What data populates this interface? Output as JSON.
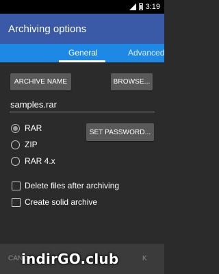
{
  "status_bar": {
    "time": "3:19",
    "icons": [
      "signal-icon",
      "battery-icon"
    ]
  },
  "app_bar": {
    "title": "Archiving options"
  },
  "tabs": [
    {
      "label": "General",
      "selected": true
    },
    {
      "label": "Advanced",
      "selected": false
    }
  ],
  "archive_name": {
    "button_label": "ARCHIVE NAME",
    "browse_label": "BROWSE...",
    "value": "samples.rar"
  },
  "format": {
    "options": [
      {
        "label": "RAR",
        "checked": true
      },
      {
        "label": "ZIP",
        "checked": false
      },
      {
        "label": "RAR 4.x",
        "checked": false
      }
    ],
    "set_password_label": "SET PASSWORD..."
  },
  "options": [
    {
      "label": "Delete files after archiving",
      "checked": false
    },
    {
      "label": "Create solid archive",
      "checked": false
    }
  ],
  "bottom_bar": {
    "cancel_label": "CANC",
    "ok_label": "K"
  },
  "watermark": "indirGO.club",
  "colors": {
    "app_bar": "#3a5aa8",
    "tab_bar": "#1e88e5",
    "background": "#2b2b2b",
    "button": "#595959"
  }
}
